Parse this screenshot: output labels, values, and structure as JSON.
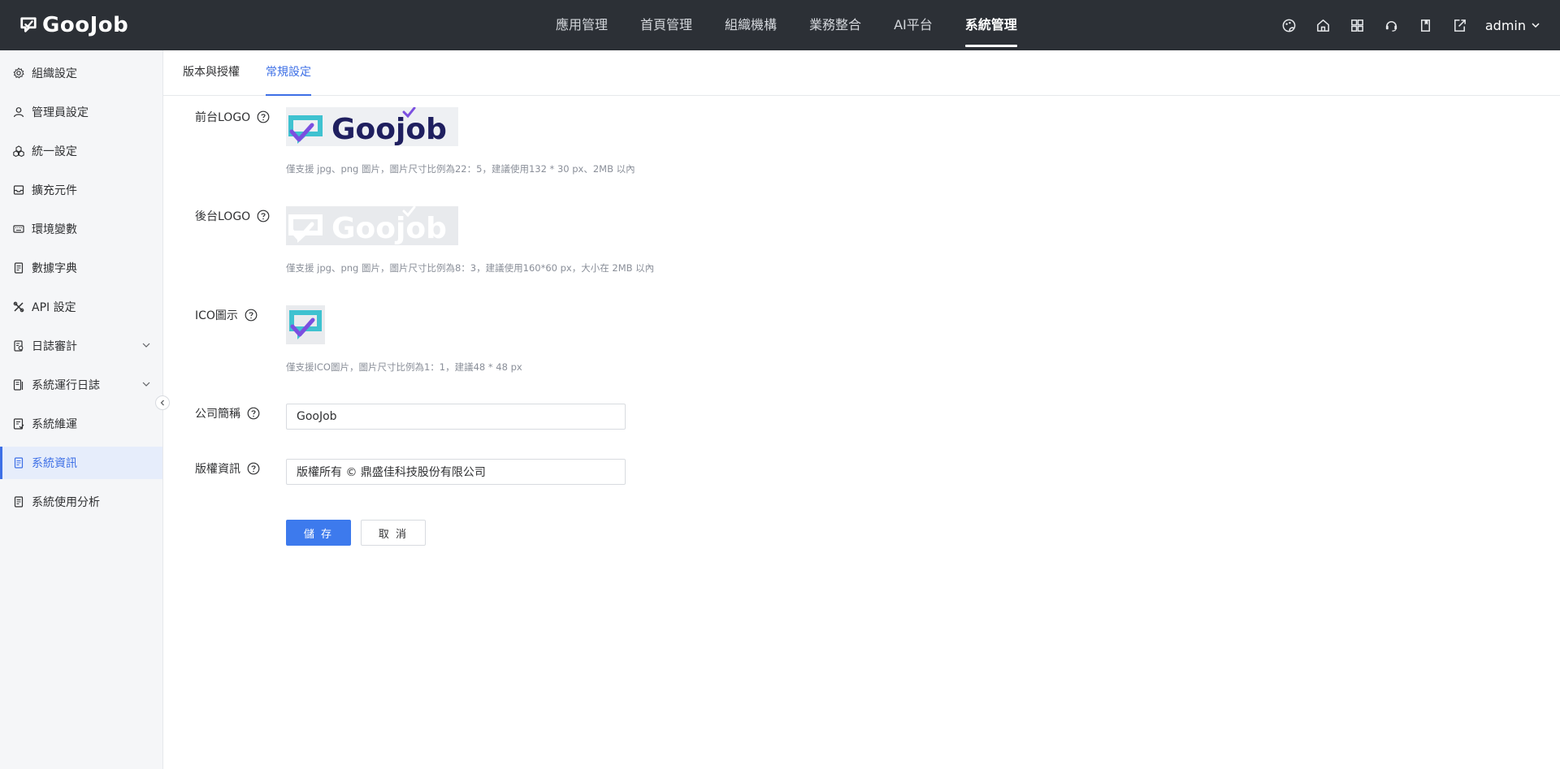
{
  "header": {
    "brand": "GooJob",
    "nav": [
      {
        "label": "應用管理",
        "active": false
      },
      {
        "label": "首頁管理",
        "active": false
      },
      {
        "label": "組織機構",
        "active": false
      },
      {
        "label": "業務整合",
        "active": false
      },
      {
        "label": "AI平台",
        "active": false
      },
      {
        "label": "系統管理",
        "active": true
      }
    ],
    "icons": [
      "palette-icon",
      "home-icon",
      "apps-grid-icon",
      "headset-icon",
      "book-icon",
      "export-icon"
    ],
    "user": "admin"
  },
  "sidebar": {
    "items": [
      {
        "label": "組織設定",
        "icon": "gear-icon"
      },
      {
        "label": "管理員設定",
        "icon": "user-icon"
      },
      {
        "label": "統一設定",
        "icon": "cubes-icon"
      },
      {
        "label": "擴充元件",
        "icon": "inbox-icon"
      },
      {
        "label": "環境變數",
        "icon": "keyboard-icon"
      },
      {
        "label": "數據字典",
        "icon": "document-icon"
      },
      {
        "label": "API 設定",
        "icon": "tools-icon"
      },
      {
        "label": "日誌審計",
        "icon": "audit-icon",
        "expandable": true
      },
      {
        "label": "系統運行日誌",
        "icon": "log-icon",
        "expandable": true
      },
      {
        "label": "系統維運",
        "icon": "maintenance-icon"
      },
      {
        "label": "系統資訊",
        "icon": "document-icon",
        "active": true
      },
      {
        "label": "系統使用分析",
        "icon": "document-icon"
      }
    ]
  },
  "tabs": [
    {
      "label": "版本與授權",
      "active": false
    },
    {
      "label": "常規設定",
      "active": true
    }
  ],
  "form": {
    "front_logo": {
      "label": "前台LOGO",
      "hint": "僅支援 jpg、png 圖片，圖片尺寸比例為22：5，建議使用132 * 30 px、2MB 以內",
      "image_text": "Goojob"
    },
    "back_logo": {
      "label": "後台LOGO",
      "hint": "僅支援 jpg、png 圖片，圖片尺寸比例為8：3，建議使用160*60 px，大小在 2MB 以內",
      "image_text": "Goojob"
    },
    "ico": {
      "label": "ICO圖示",
      "hint": "僅支援ICO圖片，圖片尺寸比例為1：1，建議48 * 48 px"
    },
    "company_short_name": {
      "label": "公司簡稱",
      "value": "GooJob"
    },
    "copyright": {
      "label": "版權資訊",
      "value": "版權所有 © 鼎盛佳科技股份有限公司"
    },
    "save_label": "儲 存",
    "cancel_label": "取 消"
  },
  "colors": {
    "topbar_bg": "#2c3036",
    "accent": "#3d6fe6",
    "primary_button": "#3d7aed",
    "logo_navy": "#1f1f5f",
    "logo_teal": "#3fc2d0",
    "logo_purple": "#7b4fe0"
  }
}
